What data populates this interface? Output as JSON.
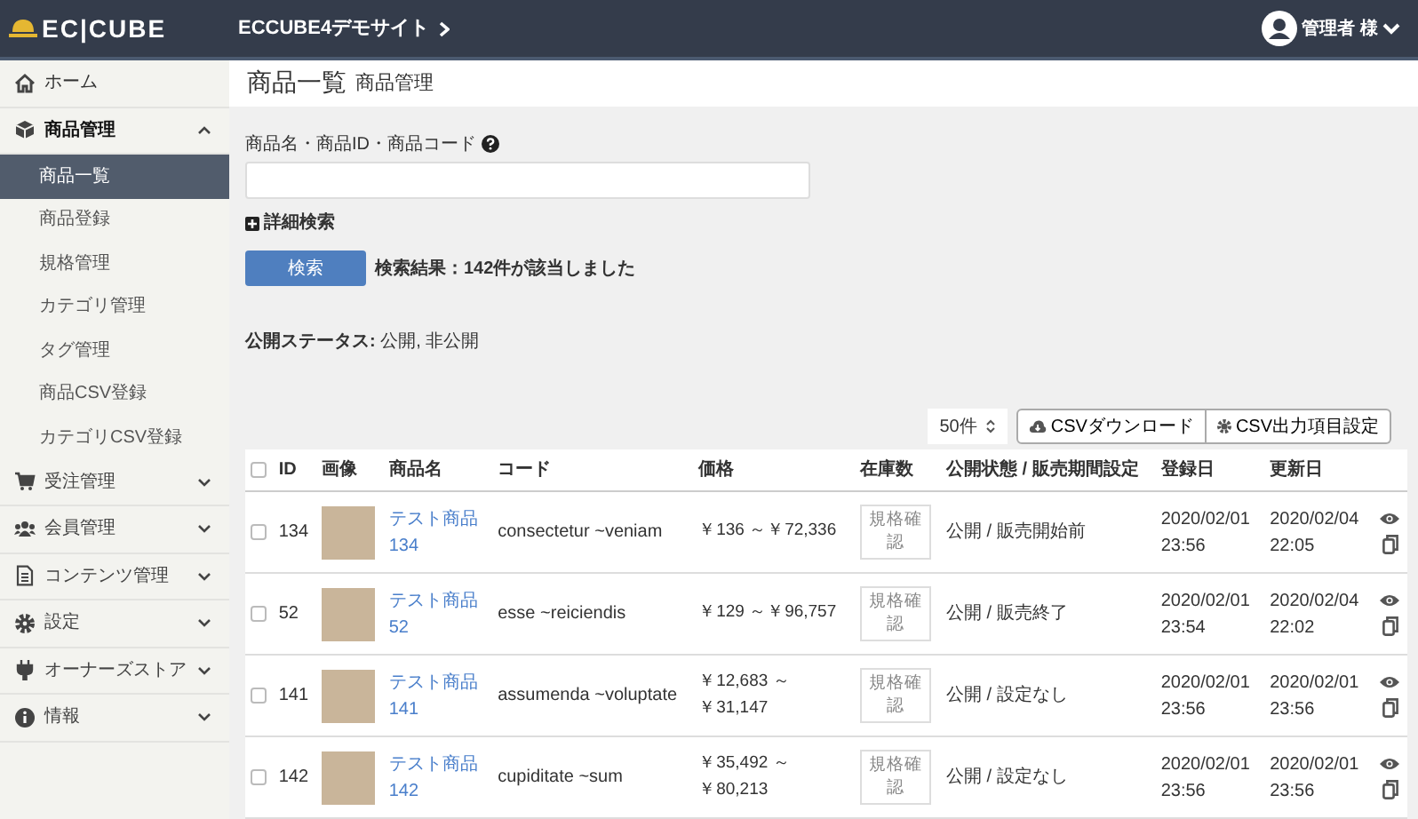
{
  "header": {
    "logo": "EC|CUBE",
    "site_name": "ECCUBE4デモサイト",
    "user": "管理者 様"
  },
  "sidebar": {
    "items": [
      {
        "label": "ホーム"
      },
      {
        "label": "商品管理",
        "expanded": true,
        "children": [
          {
            "label": "商品一覧",
            "selected": true
          },
          {
            "label": "商品登録",
            "selected": false
          },
          {
            "label": "規格管理",
            "selected": false
          },
          {
            "label": "カテゴリ管理",
            "selected": false
          },
          {
            "label": "タグ管理",
            "selected": false
          },
          {
            "label": "商品CSV登録",
            "selected": false
          },
          {
            "label": "カテゴリCSV登録",
            "selected": false
          }
        ]
      },
      {
        "label": "受注管理",
        "expanded": false
      },
      {
        "label": "会員管理",
        "expanded": false
      },
      {
        "label": "コンテンツ管理",
        "expanded": false
      },
      {
        "label": "設定",
        "expanded": false
      },
      {
        "label": "オーナーズストア",
        "expanded": false
      },
      {
        "label": "情報",
        "expanded": false
      }
    ]
  },
  "page": {
    "title": "商品一覧",
    "subtitle": "商品管理"
  },
  "search": {
    "label": "商品名・商品ID・商品コード",
    "advanced": "詳細検索",
    "button": "検索",
    "result": "検索結果：142件が該当しました",
    "status_filter": "**公開ステータス:** 公開, 非公開"
  },
  "toolbar": {
    "per_page": "50件",
    "csv_download": "CSVダウンロード",
    "csv_settings": "CSV出力項目設定"
  },
  "table": {
    "header_checked": false,
    "columns": [
      "ID",
      "画像",
      "商品名",
      "コード",
      "価格",
      "在庫数",
      "公開状態 / 販売期間設定",
      "登録日",
      "更新日"
    ],
    "rows": [
      {
        "checked": false,
        "id": "134",
        "name": "テスト商品 134",
        "code": "consectetur ~veniam",
        "price": "￥136 ～￥72,336",
        "stock": "規格確認",
        "status": "公開 / 販売開始前",
        "created": "2020/02/01 23:56",
        "updated": "2020/02/04 22:05"
      },
      {
        "checked": false,
        "id": "52",
        "name": "テスト商品 52",
        "code": "esse ~reiciendis",
        "price": "￥129 ～￥96,757",
        "stock": "規格確認",
        "status": "公開 / 販売終了",
        "created": "2020/02/01 23:54",
        "updated": "2020/02/04 22:02"
      },
      {
        "checked": false,
        "id": "141",
        "name": "テスト商品 141",
        "code": "assumenda ~voluptate",
        "price": "￥12,683 ～￥31,147",
        "stock": "規格確認",
        "status": "公開 / 設定なし",
        "created": "2020/02/01 23:56",
        "updated": "2020/02/01 23:56"
      },
      {
        "checked": false,
        "id": "142",
        "name": "テスト商品 142",
        "code": "cupiditate ~sum",
        "price": "￥35,492 ～￥80,213",
        "stock": "規格確認",
        "status": "公開 / 設定なし",
        "created": "2020/02/01 23:56",
        "updated": "2020/02/01 23:56"
      }
    ]
  }
}
